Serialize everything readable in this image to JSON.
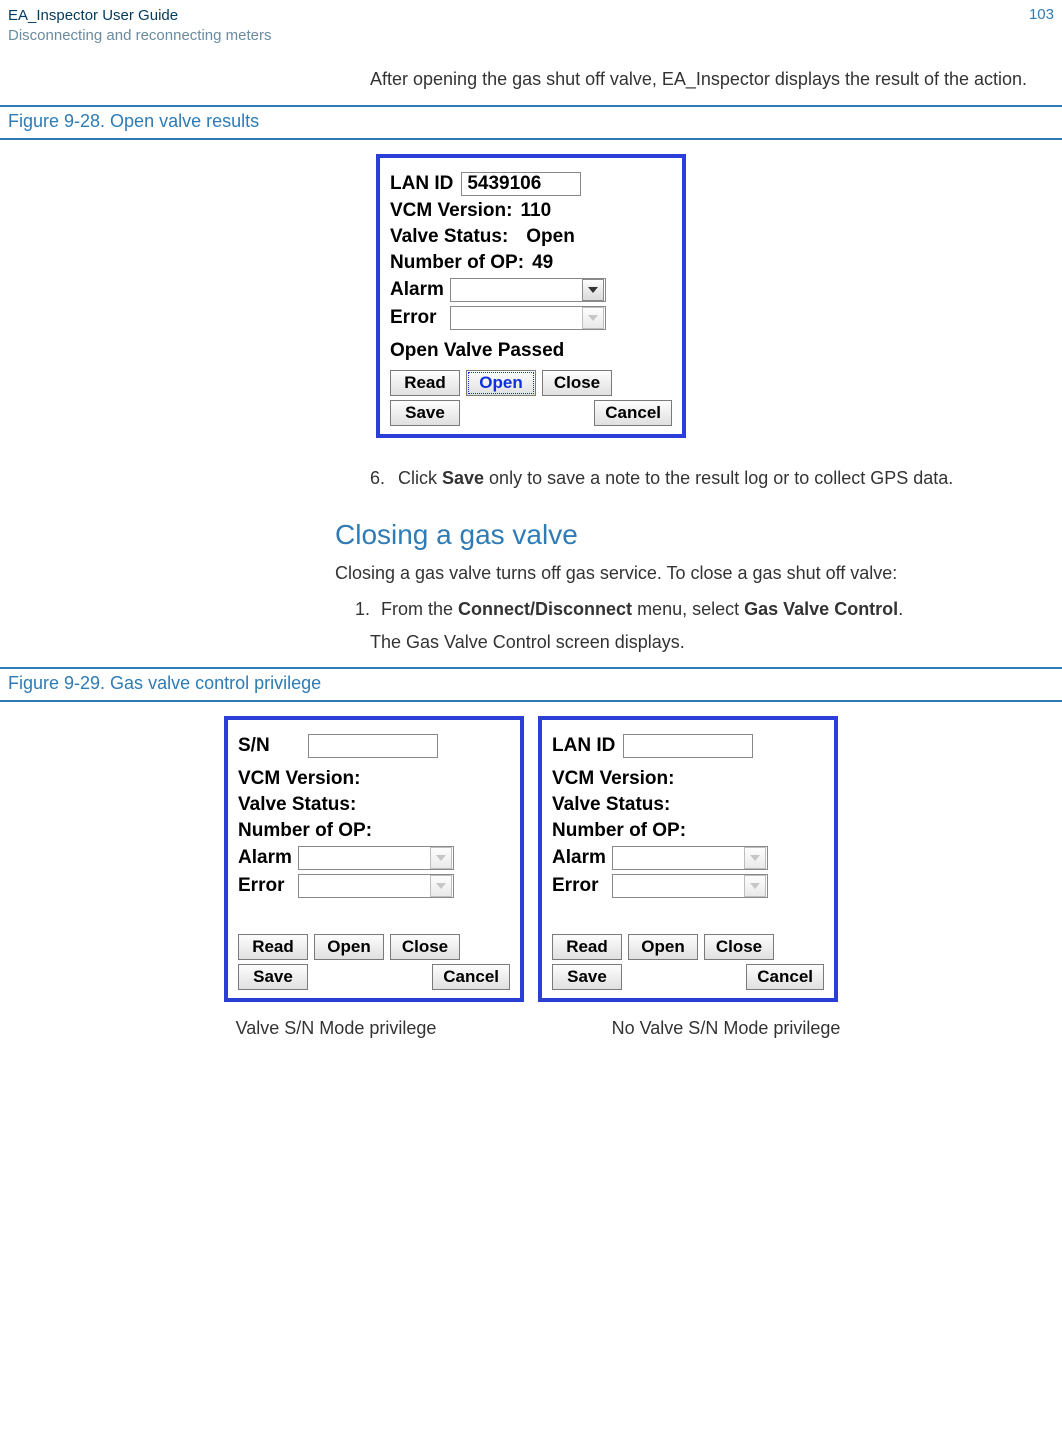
{
  "header": {
    "title": "EA_Inspector User Guide",
    "subtitle": "Disconnecting and reconnecting meters",
    "page": "103"
  },
  "intro": "After opening the gas shut off valve, EA_Inspector displays the result of the action.",
  "fig28": {
    "caption": "Figure 9-28. Open valve results",
    "lan_label": "LAN ID",
    "lan_value": "5439106",
    "vcm_label": "VCM Version:",
    "vcm_value": "110",
    "valve_label": "Valve Status:",
    "valve_value": "Open",
    "op_label": "Number of OP:",
    "op_value": "49",
    "alarm_label": "Alarm",
    "error_label": "Error",
    "status": "Open Valve Passed",
    "btn_read": "Read",
    "btn_open": "Open",
    "btn_close": "Close",
    "btn_save": "Save",
    "btn_cancel": "Cancel"
  },
  "step6": {
    "num": "6.",
    "pre": "Click ",
    "bold": "Save",
    "post": " only to save a note to the result log or to collect GPS data."
  },
  "closing": {
    "heading": "Closing a gas valve",
    "para": "Closing a gas valve turns off gas service. To close a gas shut off valve:",
    "step1_num": "1.",
    "step1_a": "From the ",
    "step1_b": "Connect/Disconnect",
    "step1_c": " menu, select ",
    "step1_d": "Gas Valve Control",
    "step1_e": ".",
    "step1_sub": "The Gas Valve Control screen displays."
  },
  "fig29": {
    "caption": "Figure 9-29. Gas valve control privilege",
    "left": {
      "id_label": "S/N",
      "vcm_label": "VCM Version:",
      "valve_label": "Valve Status:",
      "op_label": "Number of OP:",
      "alarm_label": "Alarm",
      "error_label": "Error",
      "btn_read": "Read",
      "btn_open": "Open",
      "btn_close": "Close",
      "btn_save": "Save",
      "btn_cancel": "Cancel",
      "caption": "Valve S/N Mode privilege"
    },
    "right": {
      "id_label": "LAN ID",
      "vcm_label": "VCM Version:",
      "valve_label": "Valve Status:",
      "op_label": "Number of OP:",
      "alarm_label": "Alarm",
      "error_label": "Error",
      "btn_read": "Read",
      "btn_open": "Open",
      "btn_close": "Close",
      "btn_save": "Save",
      "btn_cancel": "Cancel",
      "caption": "No Valve S/N Mode privilege"
    }
  }
}
